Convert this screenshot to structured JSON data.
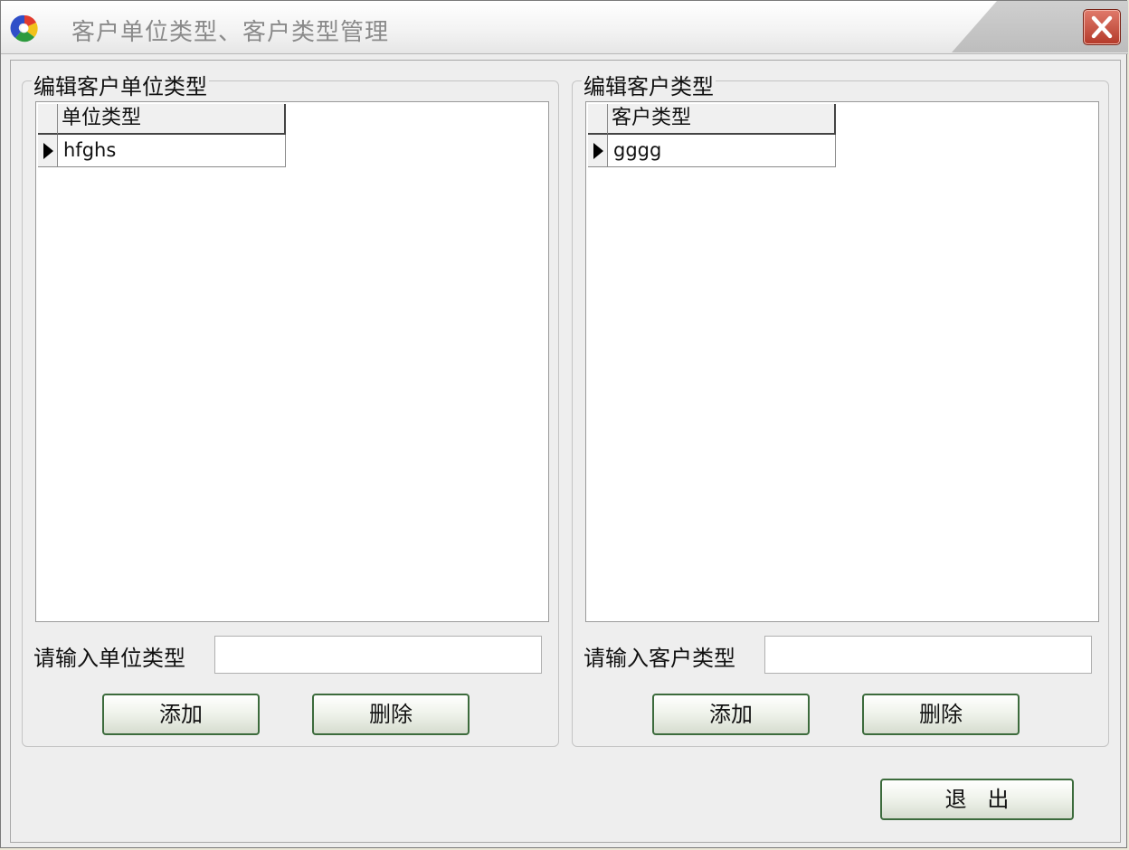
{
  "window": {
    "title": "客户单位类型、客户类型管理"
  },
  "left_panel": {
    "group_title": "编辑客户单位类型",
    "grid": {
      "column_header": "单位类型",
      "rows": [
        "hfghs"
      ]
    },
    "input_label": "请输入单位类型",
    "input_value": "",
    "add_label": "添加",
    "delete_label": "删除"
  },
  "right_panel": {
    "group_title": "编辑客户类型",
    "grid": {
      "column_header": "客户类型",
      "rows": [
        "gggg"
      ]
    },
    "input_label": "请输入客户类型",
    "input_value": "",
    "add_label": "添加",
    "delete_label": "删除"
  },
  "footer": {
    "exit_label": "退   出"
  },
  "icons": {
    "app": "app-logo-icon",
    "close": "close-icon",
    "row_indicator": "row-pointer-icon"
  },
  "colors": {
    "button_border": "#3c6b3c",
    "close_button": "#b43a2a"
  }
}
